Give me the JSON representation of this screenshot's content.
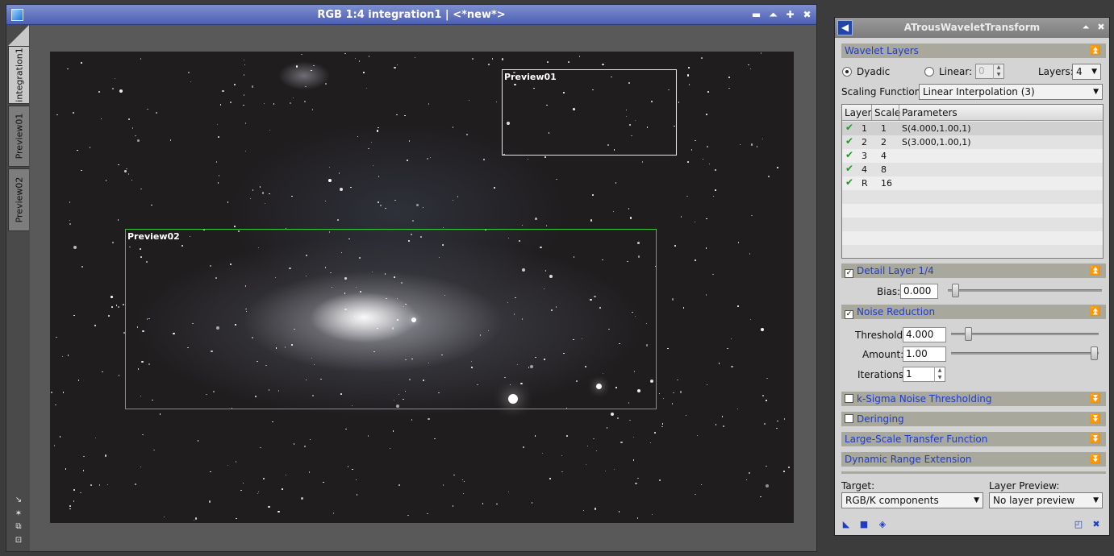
{
  "image_window": {
    "title": "RGB 1:4 integration1 | <*new*>",
    "tabs": [
      "integration1",
      "Preview01",
      "Preview02"
    ],
    "previews": [
      "Preview01",
      "Preview02"
    ],
    "colors": {
      "preview01": "#e6e6e6",
      "preview02": "#34c834"
    }
  },
  "process": {
    "title": "ATrousWaveletTransform",
    "wavelet_layers": {
      "header": "Wavelet Layers",
      "dyadic_label": "Dyadic",
      "linear_label": "Linear:",
      "linear_value": "0",
      "layers_label": "Layers:",
      "layers_value": "4",
      "scaling_label": "Scaling Function:",
      "scaling_value": "Linear Interpolation (3)",
      "table": {
        "columns": [
          "Layer",
          "Scale",
          "Parameters"
        ],
        "rows": [
          {
            "layer": "1",
            "scale": "1",
            "params": "S(4.000,1.00,1)"
          },
          {
            "layer": "2",
            "scale": "2",
            "params": "S(3.000,1.00,1)"
          },
          {
            "layer": "3",
            "scale": "4",
            "params": ""
          },
          {
            "layer": "4",
            "scale": "8",
            "params": ""
          },
          {
            "layer": "R",
            "scale": "16",
            "params": ""
          }
        ]
      }
    },
    "detail_layer": {
      "header": "Detail Layer 1/4",
      "bias_label": "Bias:",
      "bias_value": "0.000"
    },
    "noise_reduction": {
      "header": "Noise Reduction",
      "threshold_label": "Threshold:",
      "threshold_value": "4.000",
      "amount_label": "Amount:",
      "amount_value": "1.00",
      "iterations_label": "Iterations:",
      "iterations_value": "1"
    },
    "collapsed_sections": [
      "k-Sigma Noise Thresholding",
      "Deringing",
      "Large-Scale Transfer Function",
      "Dynamic Range Extension"
    ],
    "target_label": "Target:",
    "target_value": "RGB/K components",
    "layer_preview_label": "Layer Preview:",
    "layer_preview_value": "No layer preview",
    "accent_color": "#1f3cc9"
  }
}
